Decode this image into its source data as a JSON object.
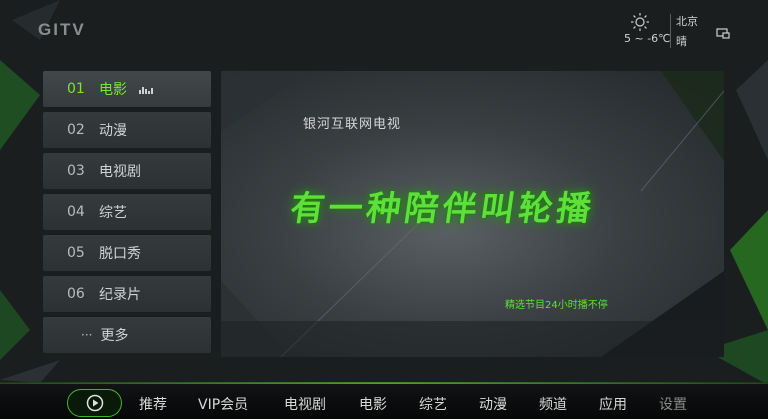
{
  "header": {
    "logo_text": "GITV",
    "weather": {
      "icon": "sun-icon",
      "temperature": "5 ~ -6℃",
      "city": "北京",
      "condition": "晴"
    },
    "screen_icon": "screen-icon"
  },
  "menu": {
    "items": [
      {
        "num": "01",
        "label": "电影",
        "active": true
      },
      {
        "num": "02",
        "label": "动漫"
      },
      {
        "num": "03",
        "label": "电视剧"
      },
      {
        "num": "04",
        "label": "综艺"
      },
      {
        "num": "05",
        "label": "脱口秀"
      },
      {
        "num": "06",
        "label": "纪录片"
      }
    ],
    "more": {
      "dots": "···",
      "label": "更多"
    }
  },
  "banner": {
    "subtitle": "银河互联网电视",
    "title": "有一种陪伴叫轮播",
    "tagline": "精选节目24小时播不停"
  },
  "bottom_nav": {
    "play_icon": "play-icon",
    "items": [
      "推荐",
      "VIP会员",
      "电视剧",
      "电影",
      "综艺",
      "动漫",
      "频道",
      "应用",
      "设置"
    ]
  },
  "colors": {
    "accent": "#7ce23a",
    "background": "#1b1e1f",
    "nav_border": "#3fb828"
  }
}
